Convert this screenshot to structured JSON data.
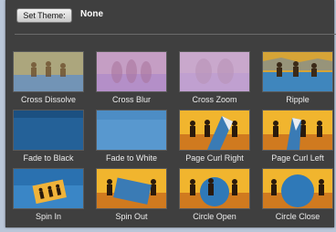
{
  "toolbar": {
    "set_theme_label": "Set Theme:",
    "theme_value": "None"
  },
  "transitions": [
    {
      "label": "Cross Dissolve",
      "preview": "cross-dissolve"
    },
    {
      "label": "Cross Blur",
      "preview": "cross-blur"
    },
    {
      "label": "Cross Zoom",
      "preview": "cross-zoom"
    },
    {
      "label": "Ripple",
      "preview": "ripple"
    },
    {
      "label": "Fade to Black",
      "preview": "fade-to-black"
    },
    {
      "label": "Fade to White",
      "preview": "fade-to-white"
    },
    {
      "label": "Page Curl Right",
      "preview": "page-curl-right"
    },
    {
      "label": "Page Curl Left",
      "preview": "page-curl-left"
    },
    {
      "label": "Spin In",
      "preview": "spin-in"
    },
    {
      "label": "Spin Out",
      "preview": "spin-out"
    },
    {
      "label": "Circle Open",
      "preview": "circle-open"
    },
    {
      "label": "Circle Close",
      "preview": "circle-close"
    }
  ],
  "colors": {
    "panel_bg": "#3f3f3f",
    "sunset": "#f2b230",
    "water": "#2f79b8"
  }
}
